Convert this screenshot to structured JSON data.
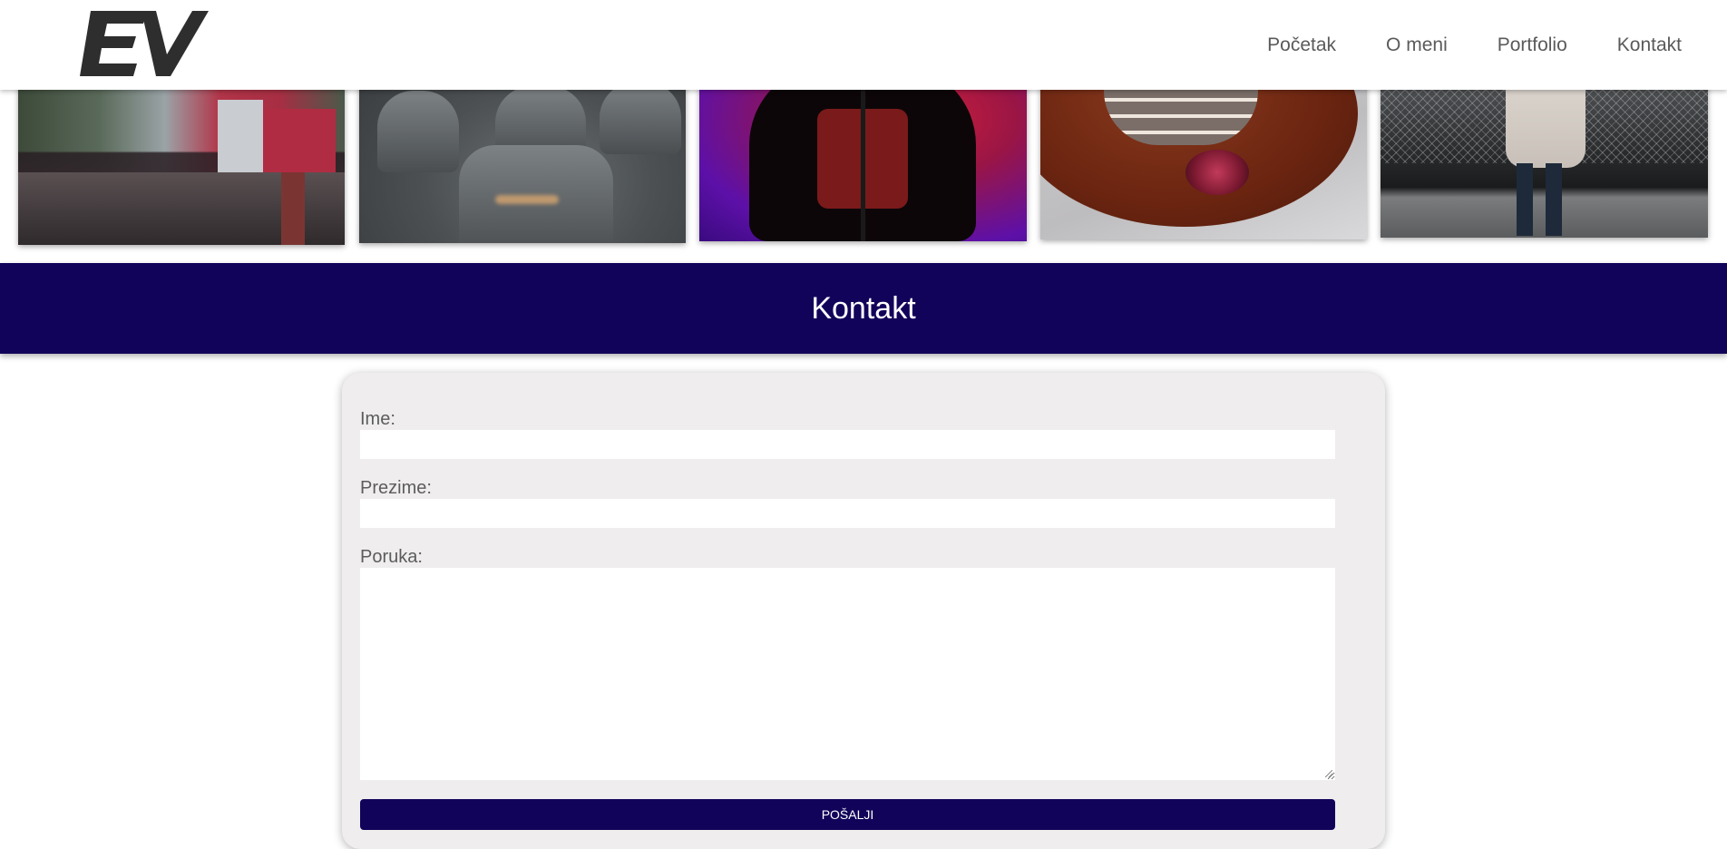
{
  "header": {
    "logo_text": "EV",
    "nav": [
      {
        "label": "Početak"
      },
      {
        "label": "O meni"
      },
      {
        "label": "Portfolio"
      },
      {
        "label": "Kontakt"
      }
    ]
  },
  "portfolio": {
    "photos": [
      {
        "subject": "city-rooftops"
      },
      {
        "subject": "bus-seats"
      },
      {
        "subject": "singer-stage"
      },
      {
        "subject": "pancakes"
      },
      {
        "subject": "person-fence"
      }
    ]
  },
  "contact": {
    "title": "Kontakt",
    "form": {
      "first_name_label": "Ime:",
      "first_name_value": "",
      "last_name_label": "Prezime:",
      "last_name_value": "",
      "message_label": "Poruka:",
      "message_value": "",
      "submit_label": "POŠALJI"
    }
  },
  "colors": {
    "accent": "#11035a",
    "card_bg": "#efedee",
    "text": "#5c5c5c"
  }
}
